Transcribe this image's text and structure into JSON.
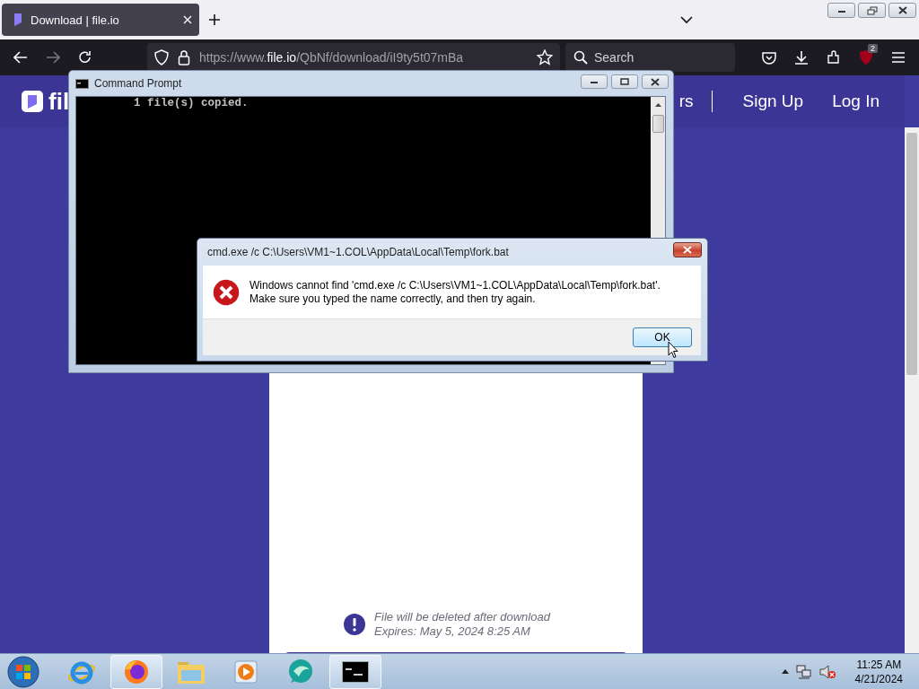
{
  "browser": {
    "tabs": [
      {
        "title": "Download | file.io",
        "selected": true
      }
    ],
    "url": {
      "scheme": "https://www.",
      "host": "file.io",
      "path": "/QbNf/download/iI9ty5t07mBa"
    },
    "search": {
      "placeholder": "Search"
    },
    "extension_badge": "2"
  },
  "page": {
    "logo_text": "fil",
    "nav_items": [
      {
        "label": "rs",
        "kind": "link"
      },
      {
        "label": "Sign Up",
        "kind": "link"
      },
      {
        "label": "Log In",
        "kind": "link"
      }
    ],
    "notice": {
      "line_1": "File will be deleted after download",
      "line_2": "Expires: May 5, 2024 8:25 AM"
    }
  },
  "cmd": {
    "title": "Command Prompt",
    "output": "        1 file(s) copied."
  },
  "dialog": {
    "title": "cmd.exe /c C:\\Users\\VM1~1.COL\\AppData\\Local\\Temp\\fork.bat",
    "message_1": "Windows cannot find 'cmd.exe /c C:\\Users\\VM1~1.COL\\AppData\\Local\\Temp\\fork.bat'.",
    "message_2": "Make sure you typed the name correctly, and then try again.",
    "button": "OK"
  },
  "taskbar": {
    "apps": [
      {
        "kind": "ie",
        "selected": false
      },
      {
        "kind": "firefox",
        "selected": true
      },
      {
        "kind": "folder",
        "selected": false
      },
      {
        "kind": "media",
        "selected": false
      },
      {
        "kind": "bubble",
        "selected": false
      },
      {
        "kind": "cmd",
        "selected": true
      }
    ],
    "time": "11:25 AM",
    "date": "4/21/2024"
  }
}
